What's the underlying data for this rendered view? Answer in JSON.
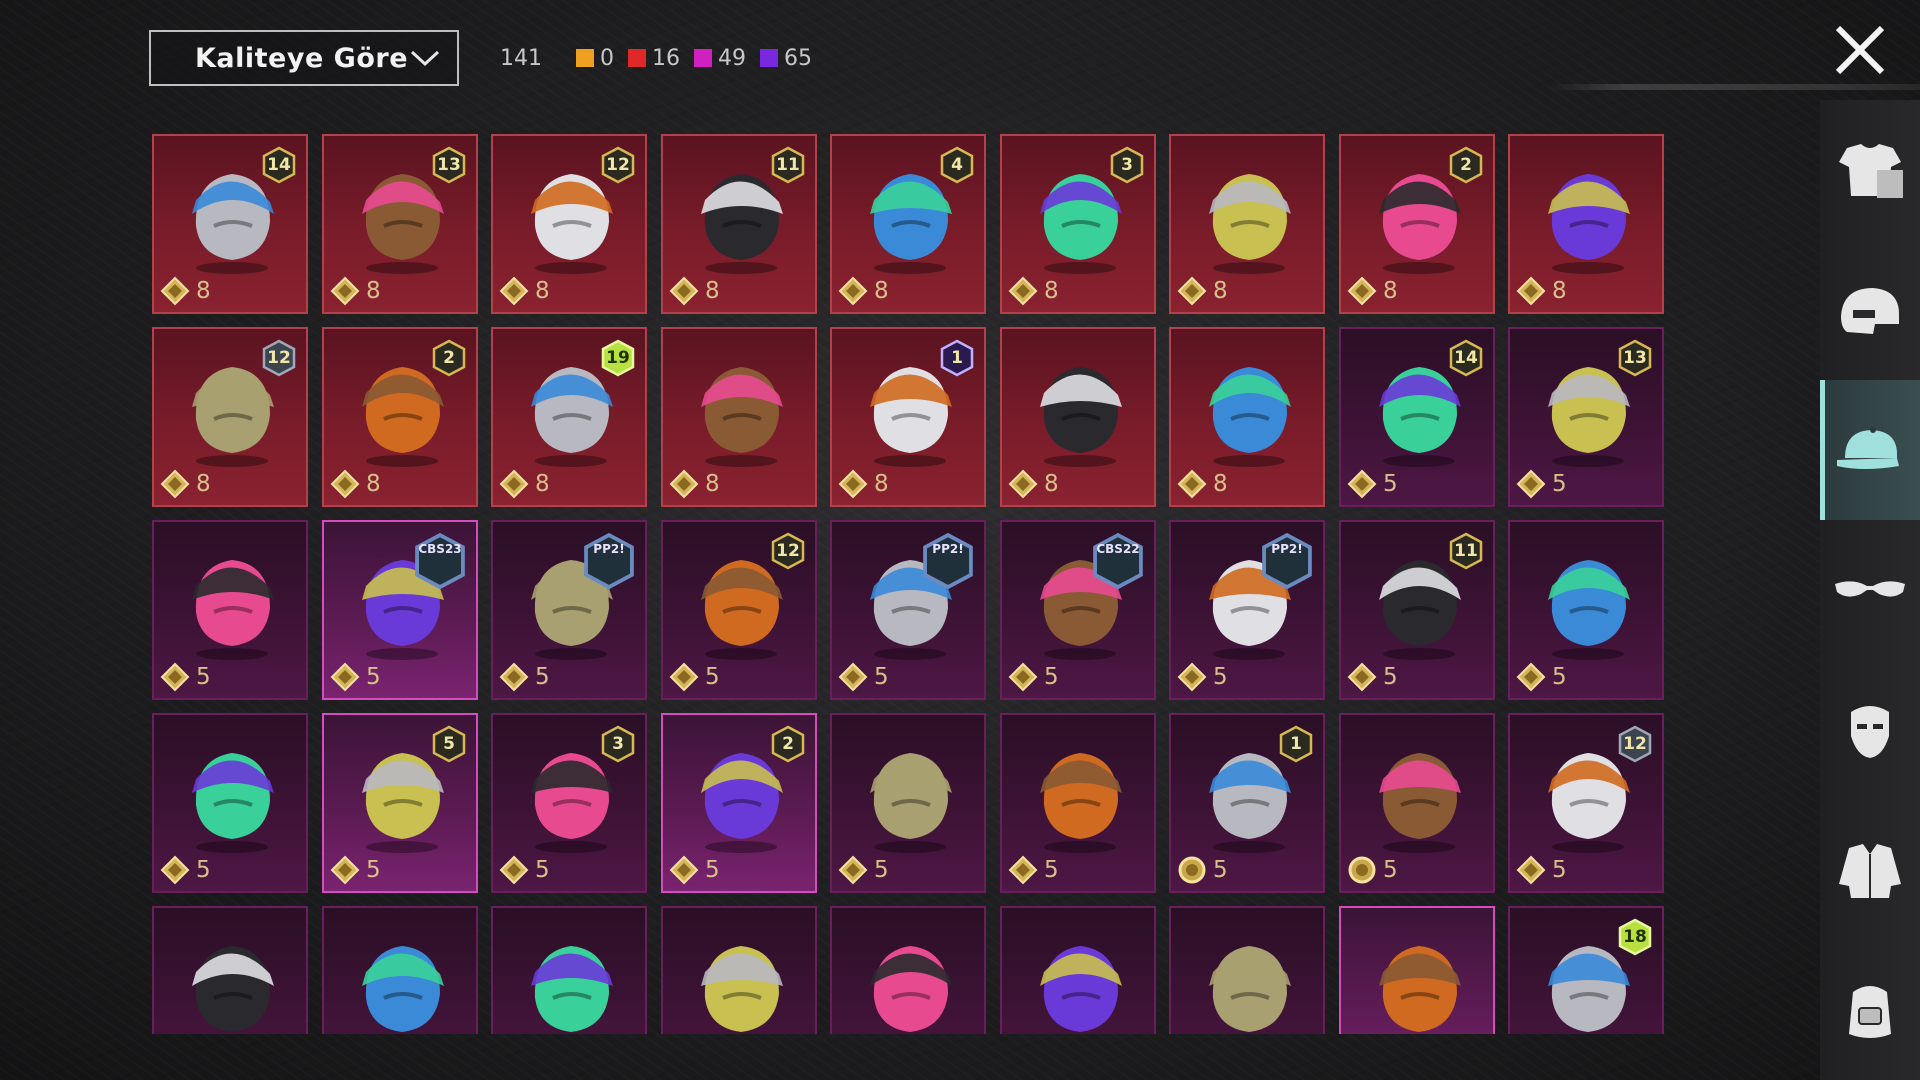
{
  "header": {
    "sort_label": "Kaliteye Göre"
  },
  "stats": {
    "total": "141",
    "counts": [
      {
        "color": "#f0a020",
        "value": "0"
      },
      {
        "color": "#e02828",
        "value": "16"
      },
      {
        "color": "#d020c0",
        "value": "49"
      },
      {
        "color": "#7a28e0",
        "value": "65"
      }
    ]
  },
  "sidebar": {
    "categories": [
      {
        "name": "outfit-category",
        "icon": "shirt-icon"
      },
      {
        "name": "helmet-category",
        "icon": "helmet-icon"
      },
      {
        "name": "hat-category",
        "icon": "cap-icon",
        "active": true
      },
      {
        "name": "glasses-category",
        "icon": "glasses-icon"
      },
      {
        "name": "mask-category",
        "icon": "mask-icon"
      },
      {
        "name": "jacket-category",
        "icon": "jacket-icon"
      },
      {
        "name": "backpack-category",
        "icon": "backpack-icon"
      }
    ]
  },
  "items": [
    {
      "tier": "red",
      "badge": "14",
      "cost": "8",
      "icon": "wolf-hood-icon"
    },
    {
      "tier": "red",
      "badge": "13",
      "cost": "8",
      "icon": "flower-hat-icon"
    },
    {
      "tier": "red",
      "badge": "12",
      "cost": "8",
      "icon": "silver-hair-icon"
    },
    {
      "tier": "red",
      "badge": "11",
      "cost": "8",
      "icon": "black-hair-icon"
    },
    {
      "tier": "red",
      "badge": "4",
      "cost": "8",
      "icon": "snowman-tophat-icon"
    },
    {
      "tier": "red",
      "badge": "3",
      "cost": "8",
      "icon": "joker-hair-icon"
    },
    {
      "tier": "red",
      "badge": "",
      "cost": "8",
      "icon": "dragon-helmet-icon"
    },
    {
      "tier": "red",
      "badge": "2",
      "cost": "8",
      "icon": "goggle-cap-icon"
    },
    {
      "tier": "red",
      "badge": "",
      "cost": "8",
      "icon": "oni-mask-icon"
    },
    {
      "tier": "red",
      "badge": "12",
      "badge_style": "gray",
      "cost": "8",
      "icon": "winged-helmet-icon"
    },
    {
      "tier": "red",
      "badge": "2",
      "cost": "8",
      "icon": "mecha-helmet-icon"
    },
    {
      "tier": "red",
      "badge": "19",
      "badge_style": "green",
      "cost": "8",
      "icon": "samurai-helmet-icon"
    },
    {
      "tier": "red",
      "badge": "",
      "cost": "8",
      "icon": "pink-bear-head-icon"
    },
    {
      "tier": "red",
      "badge": "1",
      "badge_style": "purple",
      "cost": "8",
      "icon": "purple-helmet-icon"
    },
    {
      "tier": "red",
      "badge": "",
      "cost": "8",
      "icon": "astronaut-helmet-icon"
    },
    {
      "tier": "red",
      "badge": "",
      "cost": "8",
      "icon": "tactical-helmet-icon"
    },
    {
      "tier": "purple",
      "badge": "14",
      "cost": "5",
      "icon": "flower-hair-icon"
    },
    {
      "tier": "purple",
      "badge": "13",
      "cost": "5",
      "icon": "aviator-cap-icon"
    },
    {
      "tier": "purple",
      "badge": "",
      "cost": "5",
      "icon": "pink-hair-icon"
    },
    {
      "tier": "purple",
      "sel": true,
      "badge": "CBS23",
      "badge_style": "text",
      "cost": "5",
      "icon": "cat-headphones-icon"
    },
    {
      "tier": "purple",
      "badge": "PP2!",
      "badge_style": "text",
      "cost": "5",
      "icon": "goggle-cap-icon"
    },
    {
      "tier": "purple",
      "badge": "12",
      "cost": "5",
      "icon": "brown-hair-icon"
    },
    {
      "tier": "purple",
      "badge": "PP2!",
      "badge_style": "text",
      "cost": "5",
      "icon": "monster-head-icon"
    },
    {
      "tier": "purple",
      "badge": "CBS22",
      "badge_style": "text",
      "cost": "5",
      "icon": "violet-hair-icon"
    },
    {
      "tier": "purple",
      "badge": "PP2!",
      "badge_style": "text",
      "cost": "5",
      "icon": "panda-head-icon"
    },
    {
      "tier": "purple",
      "badge": "11",
      "cost": "5",
      "icon": "flower-crown-icon"
    },
    {
      "tier": "purple",
      "badge": "",
      "cost": "5",
      "icon": "blue-dragon-icon"
    },
    {
      "tier": "purple",
      "badge": "",
      "cost": "5",
      "icon": "red-braids-icon"
    },
    {
      "tier": "purple",
      "sel": true,
      "badge": "5",
      "cost": "5",
      "icon": "pigtails-icon"
    },
    {
      "tier": "purple",
      "badge": "3",
      "cost": "5",
      "icon": "jester-hat-icon"
    },
    {
      "tier": "purple",
      "sel": true,
      "badge": "2",
      "cost": "5",
      "icon": "blonde-bandana-icon"
    },
    {
      "tier": "purple",
      "badge": "",
      "cost": "5",
      "icon": "cyber-helmet-icon"
    },
    {
      "tier": "purple",
      "badge": "",
      "cost": "5",
      "icon": "potato-head-icon"
    },
    {
      "tier": "purple",
      "badge": "1",
      "cost": "5",
      "coin": "round",
      "icon": "blue-buns-icon"
    },
    {
      "tier": "purple",
      "badge": "",
      "cost": "5",
      "coin": "round",
      "icon": "bucket-hat-icon"
    },
    {
      "tier": "purple",
      "badge": "12",
      "badge_style": "gray",
      "cost": "5",
      "icon": "box-head-icon"
    },
    {
      "tier": "purple",
      "badge": "",
      "cost": "",
      "icon": "spiked-helmet-icon"
    },
    {
      "tier": "purple",
      "badge": "",
      "cost": "",
      "icon": "horse-mask-icon"
    },
    {
      "tier": "purple",
      "badge": "",
      "cost": "",
      "icon": "knight-helmet-icon"
    },
    {
      "tier": "purple",
      "badge": "",
      "cost": "",
      "icon": "steel-helmet-icon"
    },
    {
      "tier": "purple",
      "badge": "",
      "cost": "",
      "icon": "crown-hat-icon"
    },
    {
      "tier": "purple",
      "badge": "",
      "cost": "",
      "icon": "green-mask-icon"
    },
    {
      "tier": "purple",
      "badge": "",
      "cost": "",
      "icon": "duck-hat-icon"
    },
    {
      "tier": "purple",
      "sel": true,
      "badge": "",
      "cost": "",
      "icon": "white-hair-icon"
    },
    {
      "tier": "purple",
      "badge": "18",
      "badge_style": "green",
      "cost": "",
      "icon": "plant-hat-icon"
    }
  ]
}
